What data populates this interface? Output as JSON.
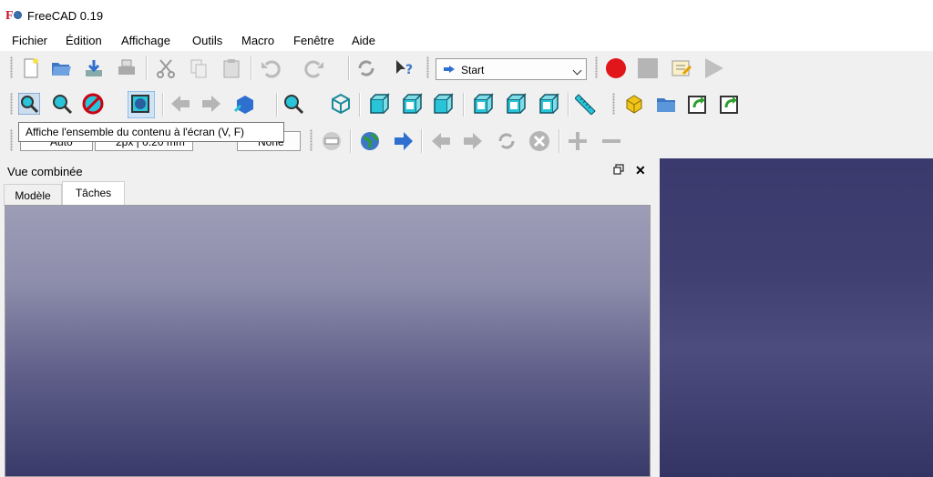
{
  "window": {
    "title": "FreeCAD 0.19",
    "logo_text": "F"
  },
  "menu": [
    "Fichier",
    "Édition",
    "Affichage",
    "Outils",
    "Macro",
    "Fenêtre",
    "Aide"
  ],
  "toolbar": {
    "workbench_selected": "Start",
    "draw_style": "Auto",
    "line_width": "2px | 0.20 mm",
    "selection_filter": "None"
  },
  "tooltip": "Affiche l'ensemble du contenu à l'écran (V, F)",
  "combo_view": {
    "title": "Vue combinée",
    "tabs": [
      "Modèle",
      "Tâches"
    ],
    "active_tab": "Tâches"
  },
  "colors": {
    "accent_cyan": "#29c4d8",
    "record_red": "#e0161b",
    "nav_blue": "#2f6fd0",
    "view_bg": "#3d3d70"
  }
}
